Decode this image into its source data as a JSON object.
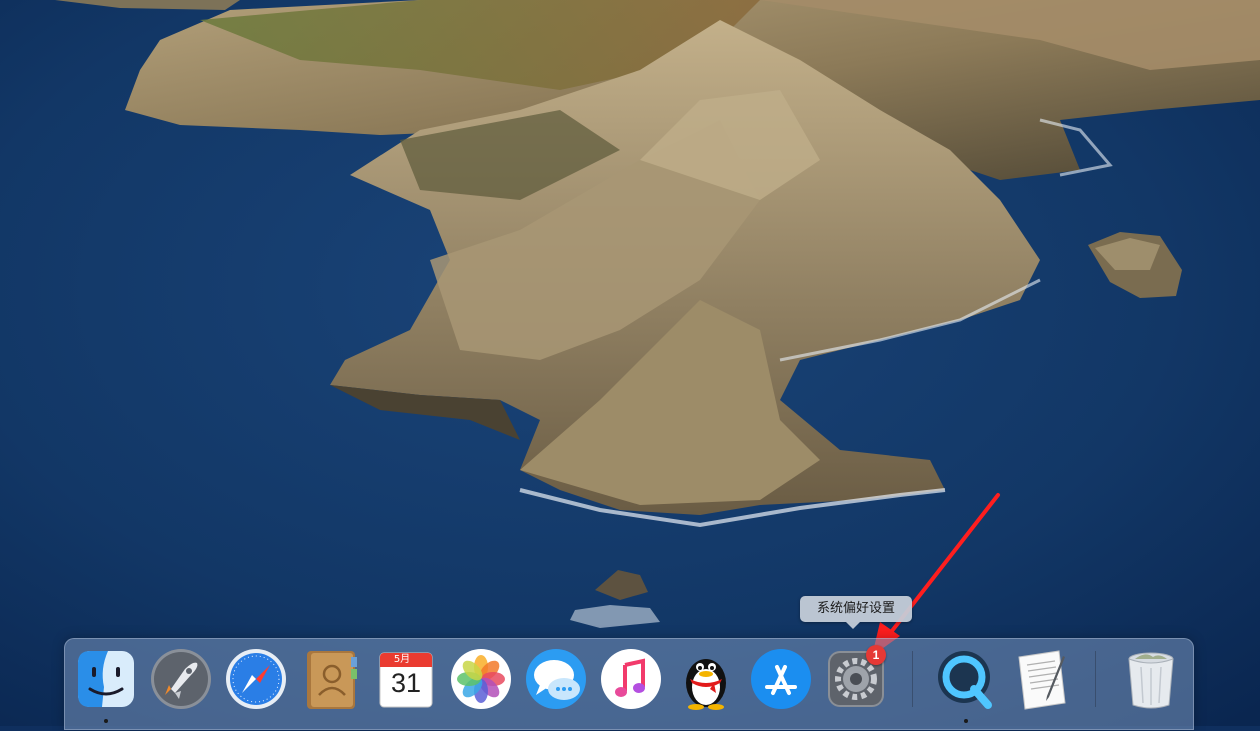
{
  "tooltip": {
    "text": "系统偏好设置"
  },
  "dock": {
    "items": [
      {
        "name": "finder",
        "icon": "finder-icon",
        "running": true
      },
      {
        "name": "launchpad",
        "icon": "rocket-icon",
        "running": false
      },
      {
        "name": "safari",
        "icon": "compass-icon",
        "running": false
      },
      {
        "name": "contacts",
        "icon": "contacts-book-icon",
        "running": false
      },
      {
        "name": "calendar",
        "icon": "calendar-icon",
        "running": false,
        "month": "5月",
        "day": "31"
      },
      {
        "name": "photos",
        "icon": "photos-flower-icon",
        "running": false
      },
      {
        "name": "messages",
        "icon": "speech-bubble-icon",
        "running": false
      },
      {
        "name": "music",
        "icon": "music-note-icon",
        "running": false
      },
      {
        "name": "qq",
        "icon": "penguin-icon",
        "running": false
      },
      {
        "name": "app-store",
        "icon": "app-store-icon",
        "running": false
      },
      {
        "name": "system-preferences",
        "icon": "gear-icon",
        "running": false,
        "badge": "1"
      },
      {
        "name": "quicktime",
        "icon": "quicktime-icon",
        "running": true
      },
      {
        "name": "textedit",
        "icon": "document-pen-icon",
        "running": false
      },
      {
        "name": "trash",
        "icon": "trash-icon",
        "running": false
      }
    ]
  },
  "colors": {
    "ocean": "#123766",
    "dock": "#7894bc",
    "annotation_arrow": "#ff1e1e",
    "badge": "#e53935"
  }
}
